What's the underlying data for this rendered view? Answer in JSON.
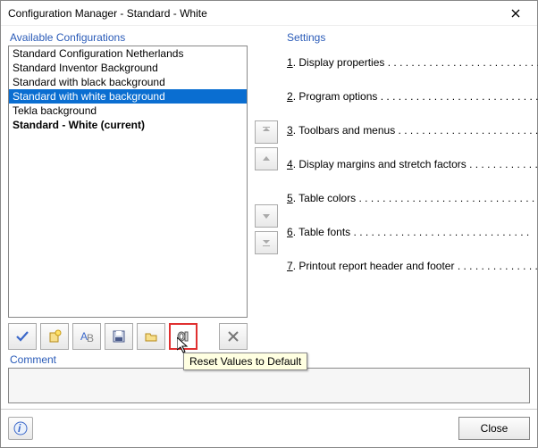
{
  "window": {
    "title": "Configuration Manager - Standard - White"
  },
  "left": {
    "group_label": "Available Configurations",
    "items": [
      {
        "label": "Standard Configuration Netherlands",
        "selected": false,
        "current": false
      },
      {
        "label": "Standard Inventor Background",
        "selected": false,
        "current": false
      },
      {
        "label": "Standard with black background",
        "selected": false,
        "current": false
      },
      {
        "label": "Standard with white background",
        "selected": true,
        "current": false
      },
      {
        "label": "Tekla background",
        "selected": false,
        "current": false
      },
      {
        "label": "Standard - White (current)",
        "selected": false,
        "current": true
      }
    ]
  },
  "toolbar": {
    "tooltip": "Reset Values to Default"
  },
  "settings": {
    "group_label": "Settings",
    "rows": [
      {
        "num": "1",
        "label": "Display properties"
      },
      {
        "num": "2",
        "label": "Program options"
      },
      {
        "num": "3",
        "label": "Toolbars and menus"
      },
      {
        "num": "4",
        "label": "Display margins and stretch factors"
      },
      {
        "num": "5",
        "label": "Table colors"
      },
      {
        "num": "6",
        "label": "Table fonts"
      },
      {
        "num": "7",
        "label": "Printout report header and footer"
      }
    ]
  },
  "comment": {
    "label": "Comment",
    "value": ""
  },
  "buttons": {
    "close": "Close"
  }
}
